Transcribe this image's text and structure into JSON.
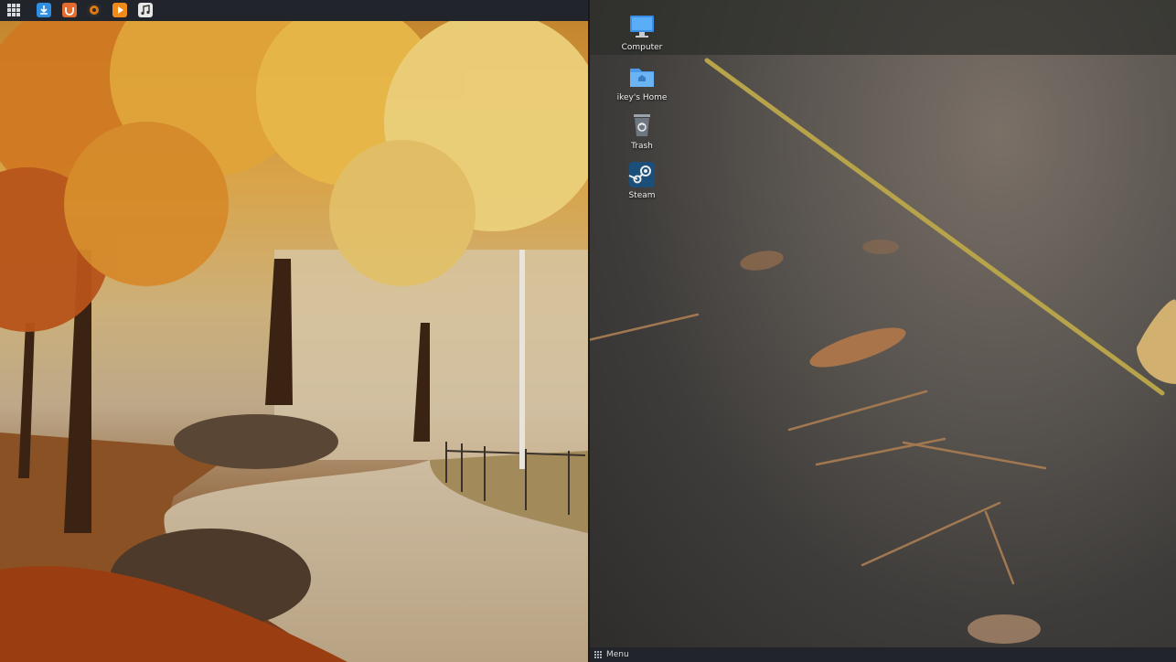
{
  "top_panel": {
    "launchers": [
      {
        "name": "downloader-icon",
        "color": "#2f8ee0"
      },
      {
        "name": "ubuntu-software-icon",
        "color": "#e46b2d"
      },
      {
        "name": "torrent-icon",
        "color": "#2b2b2b"
      },
      {
        "name": "media-player-icon",
        "color": "#f08a18"
      },
      {
        "name": "music-icon",
        "color": "#e8e8e8"
      }
    ]
  },
  "desktop": {
    "icons": [
      {
        "label": "Computer",
        "icon": "monitor-icon"
      },
      {
        "label": "ikey's Home",
        "icon": "home-folder-icon"
      },
      {
        "label": "Trash",
        "icon": "trash-icon"
      },
      {
        "label": "Steam",
        "icon": "steam-icon"
      }
    ]
  },
  "bottom_panel": {
    "menu_label": "Menu"
  },
  "colors": {
    "panel_bg": "#21252b",
    "wallpaper_left_accent": "#d9a44a",
    "wallpaper_right_accent": "#3e3c3a"
  }
}
